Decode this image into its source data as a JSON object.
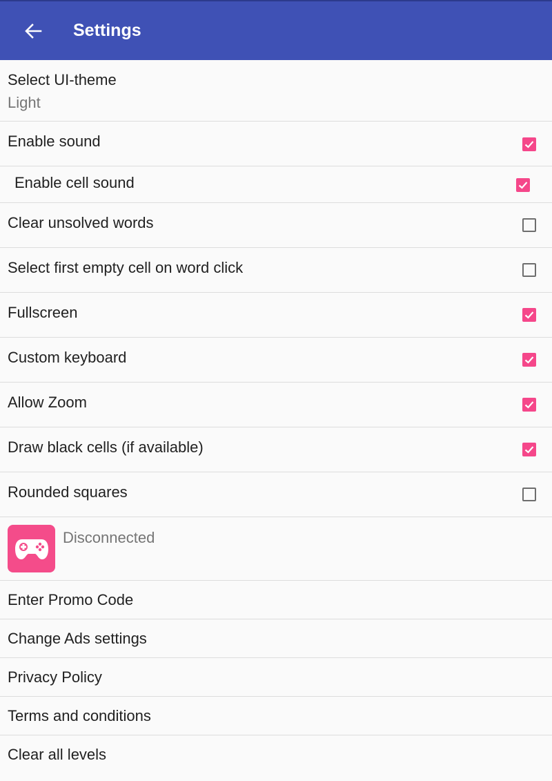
{
  "appbar": {
    "title": "Settings",
    "back_icon": "arrow-left-icon",
    "color": "#3f51b5"
  },
  "theme": {
    "label": "Select UI-theme",
    "value": "Light"
  },
  "checkboxes": [
    {
      "key": "enable_sound",
      "label": "Enable sound",
      "checked": true
    },
    {
      "key": "enable_cell_sound",
      "label": "Enable cell sound",
      "checked": true
    },
    {
      "key": "clear_unsolved_words",
      "label": "Clear unsolved words",
      "checked": false
    },
    {
      "key": "select_first_empty_cell",
      "label": "Select first empty cell on word click",
      "checked": false
    },
    {
      "key": "fullscreen",
      "label": "Fullscreen",
      "checked": true
    },
    {
      "key": "custom_keyboard",
      "label": "Custom keyboard",
      "checked": true
    },
    {
      "key": "allow_zoom",
      "label": "Allow Zoom",
      "checked": true
    },
    {
      "key": "draw_black_cells",
      "label": "Draw black cells (if available)",
      "checked": true
    },
    {
      "key": "rounded_squares",
      "label": "Rounded squares",
      "checked": false
    }
  ],
  "games": {
    "icon": "gamepad-icon",
    "status": "Disconnected"
  },
  "links": [
    "Enter Promo Code",
    "Change Ads settings",
    "Privacy Policy",
    "Terms and conditions",
    "Clear all levels"
  ],
  "accent_color": "#f5478a"
}
